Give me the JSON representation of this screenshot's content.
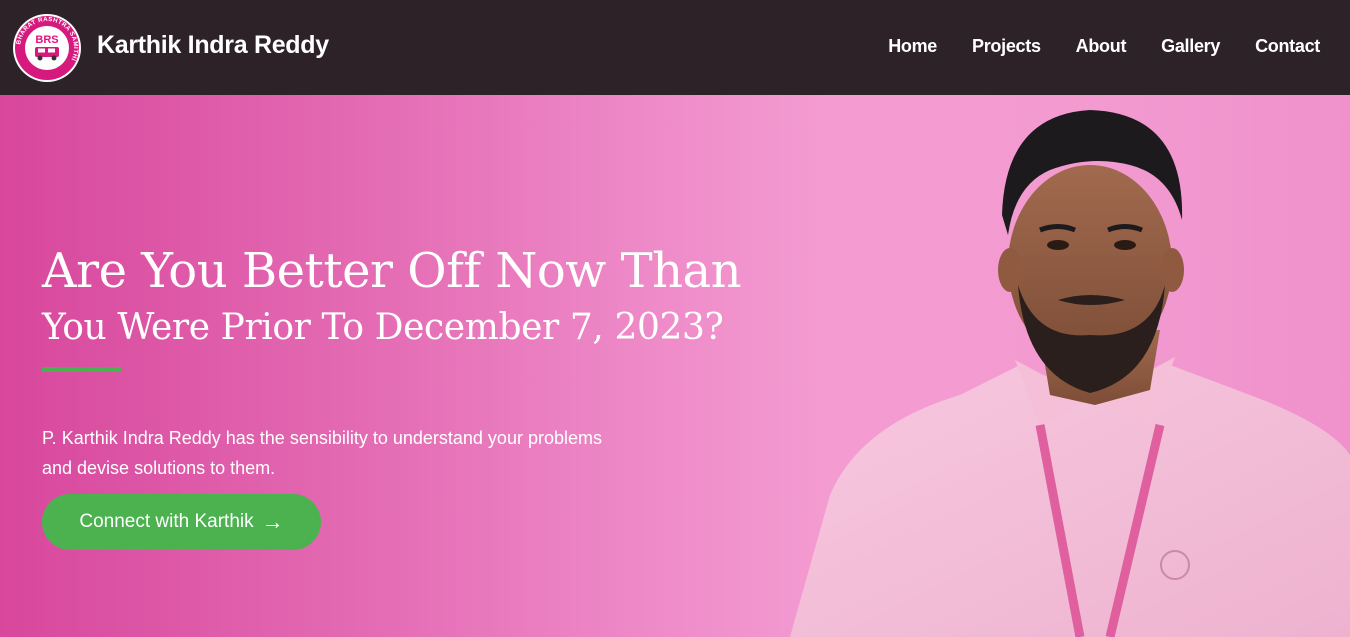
{
  "navbar": {
    "logo": {
      "text": "BRS",
      "ring_text": "BHARAT RASHTRA SAMITHI",
      "icon": "brs-logo-icon",
      "ring_color": "#d6197d",
      "text_color": "#e3127f"
    },
    "brand": "Karthik Indra Reddy",
    "links": [
      "Home",
      "Projects",
      "About",
      "Gallery",
      "Contact"
    ],
    "background": "#2e2229"
  },
  "hero": {
    "headline_line1": "Are You Better Off Now Than",
    "headline_line2": "You Were Prior To December 7, 2023?",
    "description": "P. Karthik Indra Reddy has the sensibility to understand your problems and devise solutions to them.",
    "cta_label": "Connect with Karthik",
    "cta_icon": "arrow-right-icon",
    "accent_green": "#4bb24f",
    "gradient_start": "#d8479c",
    "gradient_end": "#f39bd1",
    "portrait": "person-portrait-image"
  }
}
